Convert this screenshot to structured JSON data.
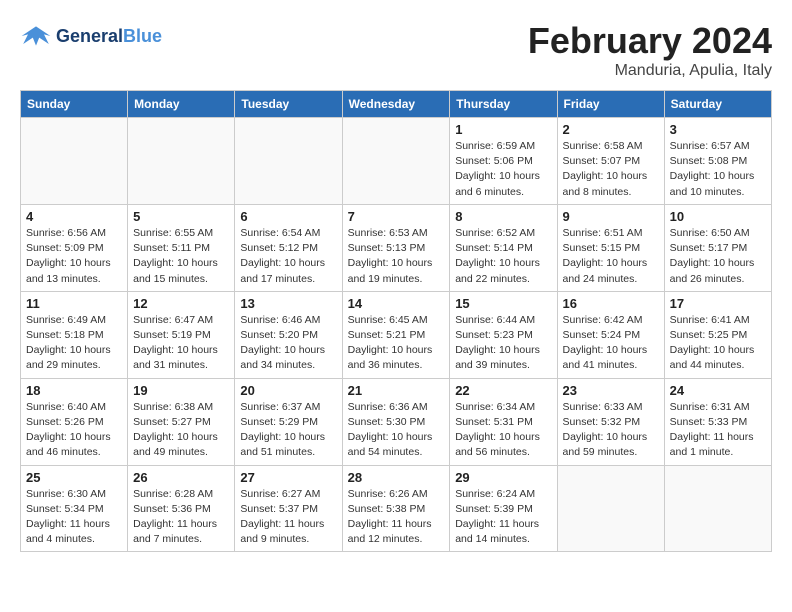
{
  "header": {
    "logo_line1": "General",
    "logo_line2": "Blue",
    "month_title": "February 2024",
    "location": "Manduria, Apulia, Italy"
  },
  "weekdays": [
    "Sunday",
    "Monday",
    "Tuesday",
    "Wednesday",
    "Thursday",
    "Friday",
    "Saturday"
  ],
  "weeks": [
    [
      {
        "day": "",
        "info": ""
      },
      {
        "day": "",
        "info": ""
      },
      {
        "day": "",
        "info": ""
      },
      {
        "day": "",
        "info": ""
      },
      {
        "day": "1",
        "info": "Sunrise: 6:59 AM\nSunset: 5:06 PM\nDaylight: 10 hours\nand 6 minutes."
      },
      {
        "day": "2",
        "info": "Sunrise: 6:58 AM\nSunset: 5:07 PM\nDaylight: 10 hours\nand 8 minutes."
      },
      {
        "day": "3",
        "info": "Sunrise: 6:57 AM\nSunset: 5:08 PM\nDaylight: 10 hours\nand 10 minutes."
      }
    ],
    [
      {
        "day": "4",
        "info": "Sunrise: 6:56 AM\nSunset: 5:09 PM\nDaylight: 10 hours\nand 13 minutes."
      },
      {
        "day": "5",
        "info": "Sunrise: 6:55 AM\nSunset: 5:11 PM\nDaylight: 10 hours\nand 15 minutes."
      },
      {
        "day": "6",
        "info": "Sunrise: 6:54 AM\nSunset: 5:12 PM\nDaylight: 10 hours\nand 17 minutes."
      },
      {
        "day": "7",
        "info": "Sunrise: 6:53 AM\nSunset: 5:13 PM\nDaylight: 10 hours\nand 19 minutes."
      },
      {
        "day": "8",
        "info": "Sunrise: 6:52 AM\nSunset: 5:14 PM\nDaylight: 10 hours\nand 22 minutes."
      },
      {
        "day": "9",
        "info": "Sunrise: 6:51 AM\nSunset: 5:15 PM\nDaylight: 10 hours\nand 24 minutes."
      },
      {
        "day": "10",
        "info": "Sunrise: 6:50 AM\nSunset: 5:17 PM\nDaylight: 10 hours\nand 26 minutes."
      }
    ],
    [
      {
        "day": "11",
        "info": "Sunrise: 6:49 AM\nSunset: 5:18 PM\nDaylight: 10 hours\nand 29 minutes."
      },
      {
        "day": "12",
        "info": "Sunrise: 6:47 AM\nSunset: 5:19 PM\nDaylight: 10 hours\nand 31 minutes."
      },
      {
        "day": "13",
        "info": "Sunrise: 6:46 AM\nSunset: 5:20 PM\nDaylight: 10 hours\nand 34 minutes."
      },
      {
        "day": "14",
        "info": "Sunrise: 6:45 AM\nSunset: 5:21 PM\nDaylight: 10 hours\nand 36 minutes."
      },
      {
        "day": "15",
        "info": "Sunrise: 6:44 AM\nSunset: 5:23 PM\nDaylight: 10 hours\nand 39 minutes."
      },
      {
        "day": "16",
        "info": "Sunrise: 6:42 AM\nSunset: 5:24 PM\nDaylight: 10 hours\nand 41 minutes."
      },
      {
        "day": "17",
        "info": "Sunrise: 6:41 AM\nSunset: 5:25 PM\nDaylight: 10 hours\nand 44 minutes."
      }
    ],
    [
      {
        "day": "18",
        "info": "Sunrise: 6:40 AM\nSunset: 5:26 PM\nDaylight: 10 hours\nand 46 minutes."
      },
      {
        "day": "19",
        "info": "Sunrise: 6:38 AM\nSunset: 5:27 PM\nDaylight: 10 hours\nand 49 minutes."
      },
      {
        "day": "20",
        "info": "Sunrise: 6:37 AM\nSunset: 5:29 PM\nDaylight: 10 hours\nand 51 minutes."
      },
      {
        "day": "21",
        "info": "Sunrise: 6:36 AM\nSunset: 5:30 PM\nDaylight: 10 hours\nand 54 minutes."
      },
      {
        "day": "22",
        "info": "Sunrise: 6:34 AM\nSunset: 5:31 PM\nDaylight: 10 hours\nand 56 minutes."
      },
      {
        "day": "23",
        "info": "Sunrise: 6:33 AM\nSunset: 5:32 PM\nDaylight: 10 hours\nand 59 minutes."
      },
      {
        "day": "24",
        "info": "Sunrise: 6:31 AM\nSunset: 5:33 PM\nDaylight: 11 hours\nand 1 minute."
      }
    ],
    [
      {
        "day": "25",
        "info": "Sunrise: 6:30 AM\nSunset: 5:34 PM\nDaylight: 11 hours\nand 4 minutes."
      },
      {
        "day": "26",
        "info": "Sunrise: 6:28 AM\nSunset: 5:36 PM\nDaylight: 11 hours\nand 7 minutes."
      },
      {
        "day": "27",
        "info": "Sunrise: 6:27 AM\nSunset: 5:37 PM\nDaylight: 11 hours\nand 9 minutes."
      },
      {
        "day": "28",
        "info": "Sunrise: 6:26 AM\nSunset: 5:38 PM\nDaylight: 11 hours\nand 12 minutes."
      },
      {
        "day": "29",
        "info": "Sunrise: 6:24 AM\nSunset: 5:39 PM\nDaylight: 11 hours\nand 14 minutes."
      },
      {
        "day": "",
        "info": ""
      },
      {
        "day": "",
        "info": ""
      }
    ]
  ]
}
